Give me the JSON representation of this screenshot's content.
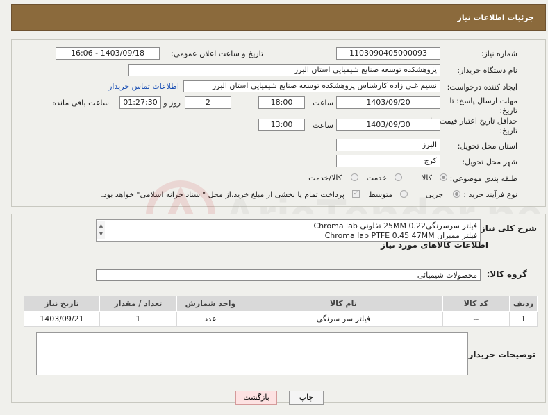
{
  "header": {
    "title": "جزئیات اطلاعات نیاز"
  },
  "form": {
    "need_number_label": "شماره نیاز:",
    "need_number": "1103090405000093",
    "announce_label": "تاریخ و ساعت اعلان عمومی:",
    "announce_value": "1403/09/18 - 16:06",
    "buyer_label": "نام دستگاه خریدار:",
    "buyer_value": "پژوهشکده توسعه صنایع شیمیایی استان البرز",
    "creator_label": "ایجاد کننده درخواست:",
    "creator_value": "نسیم غنی زاده کارشناس پژوهشکده توسعه صنایع شیمیایی استان البرز",
    "buyer_contact_link": "اطلاعات تماس خریدار",
    "deadline_label_1": "مهلت ارسال پاسخ: تا",
    "deadline_label_2": "تاریخ:",
    "deadline_date": "1403/09/20",
    "time_label": "ساعت",
    "deadline_time": "18:00",
    "days_value": "2",
    "days_label": "روز و",
    "remaining_value": "01:27:30",
    "remaining_label": "ساعت باقی مانده",
    "price_label_1": "حداقل تاریخ اعتبار قیمت: تا",
    "price_label_2": "تاریخ:",
    "price_date": "1403/09/30",
    "price_time_label": "ساعت",
    "price_time": "13:00",
    "province_label": "استان محل تحویل:",
    "province_value": "البرز",
    "city_label": "شهر محل تحویل:",
    "city_value": "کرج",
    "category_label": "طبقه بندی موضوعی:",
    "category_options": [
      "کالا",
      "خدمت",
      "کالا/خدمت"
    ],
    "process_label": "نوع فرآیند خرید :",
    "process_options": [
      "جزیی",
      "متوسط"
    ],
    "payment_note": "پرداخت تمام یا بخشی از مبلغ خرید،از محل \"اسناد خزانه اسلامی\" خواهد بود."
  },
  "need": {
    "summary_label": "شرح کلی نیاز:",
    "summary_line_1": "فیلتر سرسرنگی0.22   25MM  تفلونی Chroma lab",
    "summary_line_2": "فیلتر ممبران Chroma lab PTFE   0.45     47MM",
    "goods_title": "اطلاعات کالاهای مورد نیاز",
    "group_label": "گروه کالا:",
    "group_value": "محصولات شیمیائی"
  },
  "table": {
    "headers": [
      "ردیف",
      "کد کالا",
      "نام کالا",
      "واحد شمارش",
      "تعداد / مقدار",
      "تاریخ نیاز"
    ],
    "rows": [
      [
        "1",
        "--",
        "فیلتر سر سرنگی",
        "عدد",
        "1",
        "1403/09/21"
      ]
    ]
  },
  "buyer_notes_label": "توضیحات خریدار:",
  "buttons": {
    "print": "چاپ",
    "back": "بازگشت"
  },
  "watermark_text": "AriaTender.neT"
}
